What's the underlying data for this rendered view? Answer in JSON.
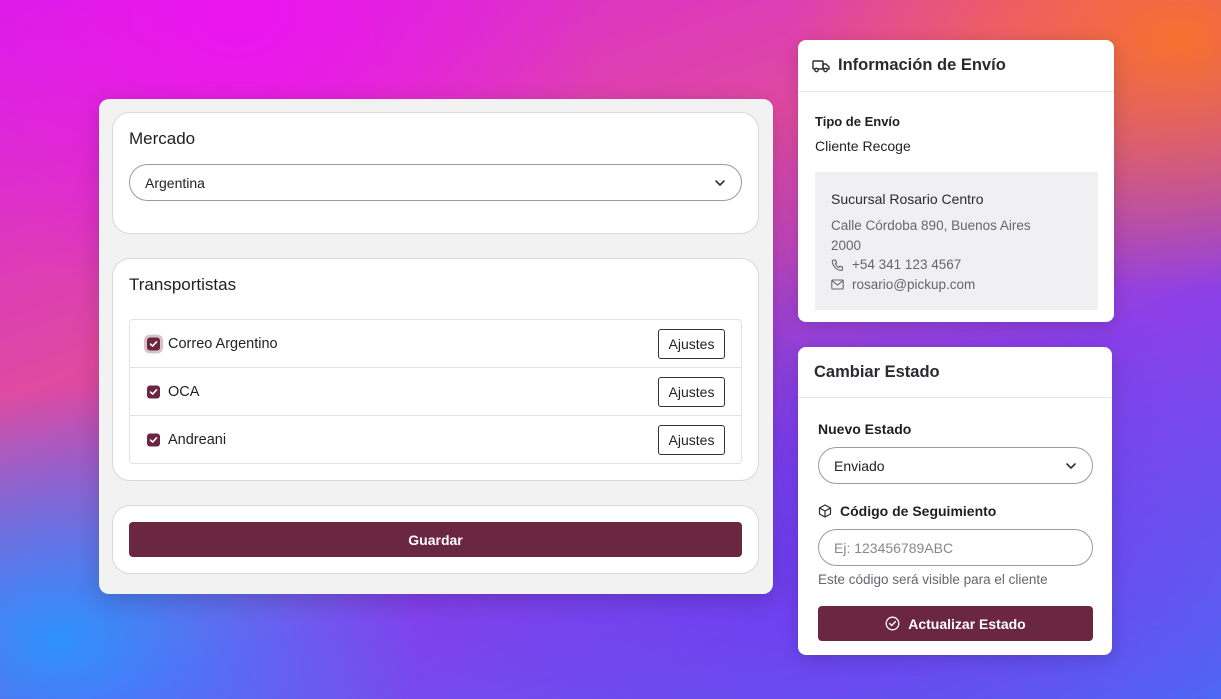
{
  "market": {
    "title": "Mercado",
    "selected": "Argentina"
  },
  "carriers": {
    "title": "Transportistas",
    "items": [
      {
        "name": "Correo Argentino",
        "checked": true,
        "settings_label": "Ajustes"
      },
      {
        "name": "OCA",
        "checked": true,
        "settings_label": "Ajustes"
      },
      {
        "name": "Andreani",
        "checked": true,
        "settings_label": "Ajustes"
      }
    ]
  },
  "save": {
    "label": "Guardar"
  },
  "shipping": {
    "title": "Información de Envío",
    "type_label": "Tipo de Envío",
    "type_value": "Cliente Recoge",
    "branch": {
      "name": "Sucursal Rosario Centro",
      "address_line1": "Calle Córdoba 890, Buenos Aires",
      "address_line2": "2000",
      "phone": "+54 341 123 4567",
      "email": "rosario@pickup.com"
    }
  },
  "status": {
    "title": "Cambiar Estado",
    "new_state_label": "Nuevo Estado",
    "new_state_value": "Enviado",
    "tracking_label": "Código de Seguimiento",
    "tracking_placeholder": "Ej: 123456789ABC",
    "tracking_help": "Este código será visible para el cliente",
    "update_label": "Actualizar Estado"
  },
  "colors": {
    "accent": "#6b2740",
    "panel_bg": "#f2f2f3"
  }
}
